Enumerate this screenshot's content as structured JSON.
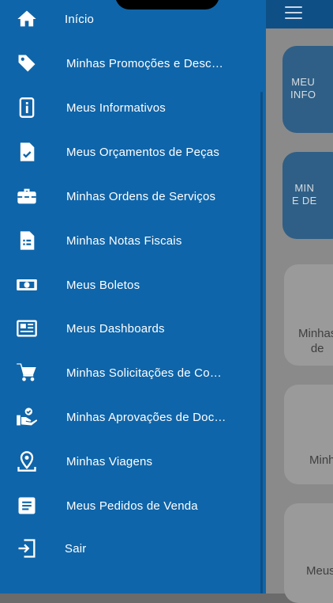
{
  "menu": {
    "items": [
      {
        "label": "Início",
        "icon": "home-icon"
      },
      {
        "label": "Minhas Promoções e Descontos",
        "icon": "tag-icon"
      },
      {
        "label": "Meus Informativos",
        "icon": "info-icon"
      },
      {
        "label": "Meus Orçamentos de Peças",
        "icon": "document-check-icon"
      },
      {
        "label": "Minhas Ordens de Serviços",
        "icon": "toolbox-icon"
      },
      {
        "label": "Minhas Notas Fiscais",
        "icon": "invoice-icon"
      },
      {
        "label": "Meus Boletos",
        "icon": "money-icon"
      },
      {
        "label": "Meus Dashboards",
        "icon": "dashboard-icon"
      },
      {
        "label": "Minhas Solicitações de Compra",
        "icon": "cart-icon"
      },
      {
        "label": "Minhas Aprovações de Documentos",
        "icon": "approval-icon"
      },
      {
        "label": "Minhas Viagens",
        "icon": "location-pin-icon"
      },
      {
        "label": "Meus Pedidos de Venda",
        "icon": "list-document-icon"
      },
      {
        "label": "Sair",
        "icon": "logout-icon"
      }
    ]
  },
  "background": {
    "cards": [
      {
        "text": "MEU\nINFO"
      },
      {
        "text": "MIN\nE DE"
      },
      {
        "text": "Minhas\nde"
      },
      {
        "text": "Minh"
      },
      {
        "text": "Meus"
      }
    ]
  },
  "colors": {
    "drawer": "#0f65a9",
    "topbar": "#0e4f86",
    "text": "#ffffff"
  }
}
